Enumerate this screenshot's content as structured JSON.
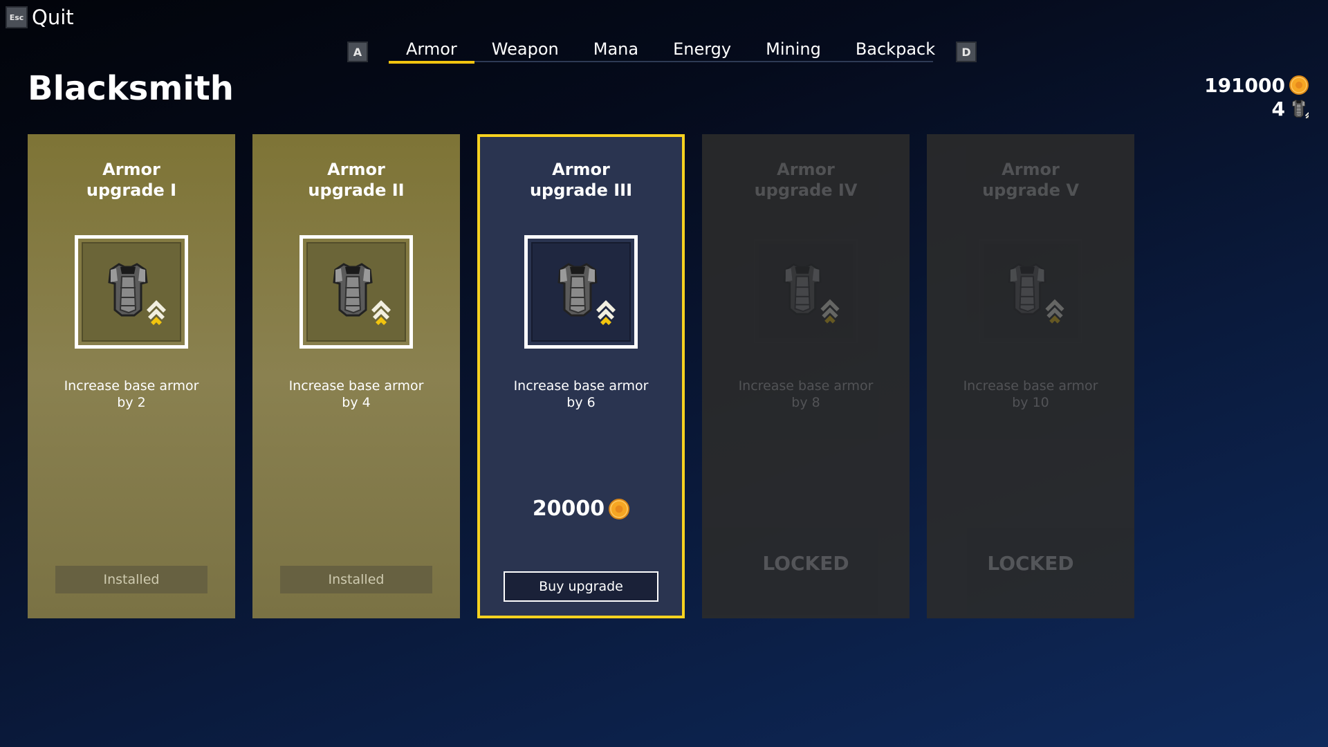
{
  "header": {
    "quit_key": "Esc",
    "quit_label": "Quit",
    "prev_key": "A",
    "next_key": "D",
    "tabs": [
      {
        "label": "Armor",
        "active": true
      },
      {
        "label": "Weapon",
        "active": false
      },
      {
        "label": "Mana",
        "active": false
      },
      {
        "label": "Energy",
        "active": false
      },
      {
        "label": "Mining",
        "active": false
      },
      {
        "label": "Backpack",
        "active": false
      }
    ]
  },
  "page": {
    "title": "Blacksmith"
  },
  "currency": {
    "coins": "191000",
    "coin_icon": "gold-coin-icon",
    "armor_count": "4",
    "armor_icon": "armor-icon"
  },
  "cards": [
    {
      "title_line1": "Armor",
      "title_line2": "upgrade I",
      "desc_line1": "Increase base armor",
      "desc_line2": "by 2",
      "state": "installed",
      "button_label": "Installed",
      "icon": "armor-upgrade-icon"
    },
    {
      "title_line1": "Armor",
      "title_line2": "upgrade II",
      "desc_line1": "Increase base armor",
      "desc_line2": "by 4",
      "state": "installed",
      "button_label": "Installed",
      "icon": "armor-upgrade-icon"
    },
    {
      "title_line1": "Armor",
      "title_line2": "upgrade III",
      "desc_line1": "Increase base armor",
      "desc_line2": "by 6",
      "state": "available",
      "price": "20000",
      "button_label": "Buy upgrade",
      "icon": "armor-upgrade-icon"
    },
    {
      "title_line1": "Armor",
      "title_line2": "upgrade IV",
      "desc_line1": "Increase base armor",
      "desc_line2": "by 8",
      "state": "locked",
      "status_label": "LOCKED",
      "icon": "armor-upgrade-icon"
    },
    {
      "title_line1": "Armor",
      "title_line2": "upgrade V",
      "desc_line1": "Increase base armor",
      "desc_line2": "by 10",
      "state": "locked",
      "status_label": "LOCKED",
      "icon": "armor-upgrade-icon"
    }
  ],
  "colors": {
    "accent": "#f7d21f",
    "installed_card": "#857b45",
    "current_card": "#2a3450",
    "locked_card": "#2b2b2b",
    "coin": "#f6a623"
  }
}
